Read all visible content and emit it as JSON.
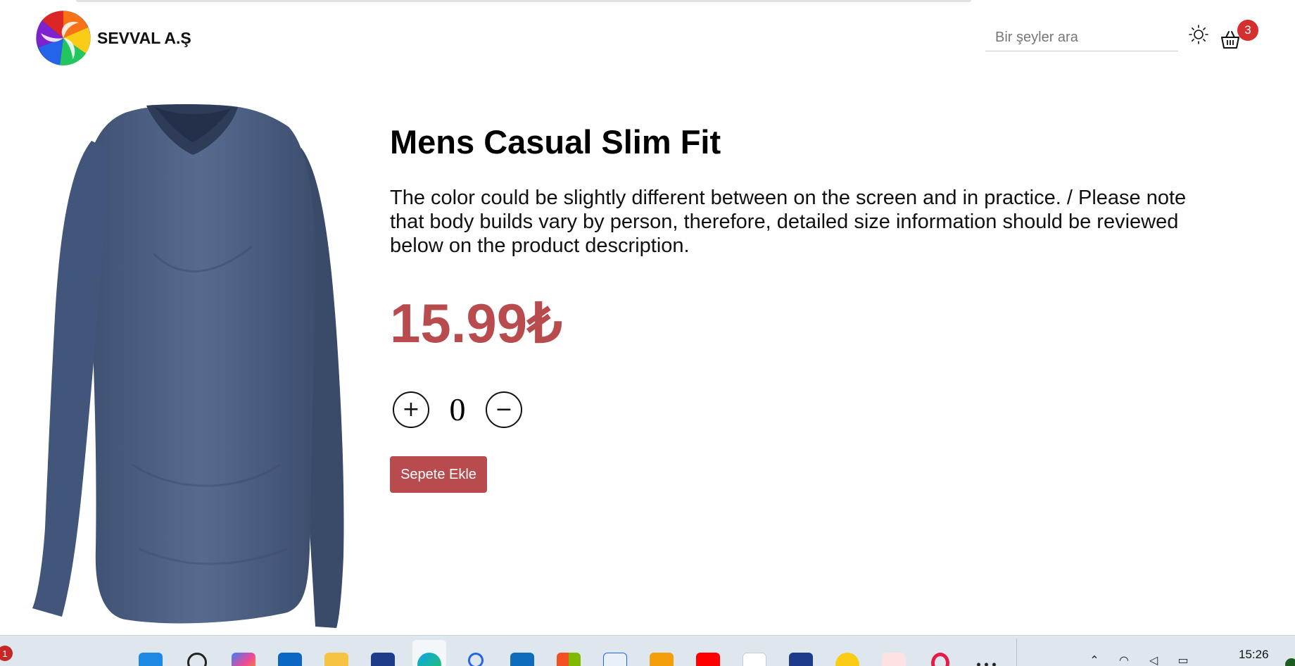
{
  "header": {
    "brand_name": "SEVVAL A.Ş",
    "search_placeholder": "Bir şeyler ara",
    "cart_count": "3"
  },
  "product": {
    "title": "Mens Casual Slim Fit",
    "description": "The color could be slightly different between on the screen and in practice. / Please note that body builds vary by person, therefore, detailed size information should be reviewed below on the product description.",
    "price": "15.99₺",
    "quantity": "0",
    "plus_label": "+",
    "minus_label": "−",
    "add_to_cart_label": "Sepete Ekle"
  },
  "taskbar": {
    "notification_count": "1",
    "time": "15:26",
    "apps": [
      "windows-start",
      "search",
      "copilot",
      "linkedin",
      "file-explorer",
      "app-l",
      "edge",
      "search-app",
      "outlook",
      "microsoft-store",
      "isu",
      "notes",
      "youtube",
      "web-app",
      "app-triangles",
      "app-h",
      "app-c",
      "opera",
      "more"
    ]
  },
  "colors": {
    "accent": "#b84b4e",
    "badge": "#d32f2f",
    "shirt": "#4f6385"
  }
}
